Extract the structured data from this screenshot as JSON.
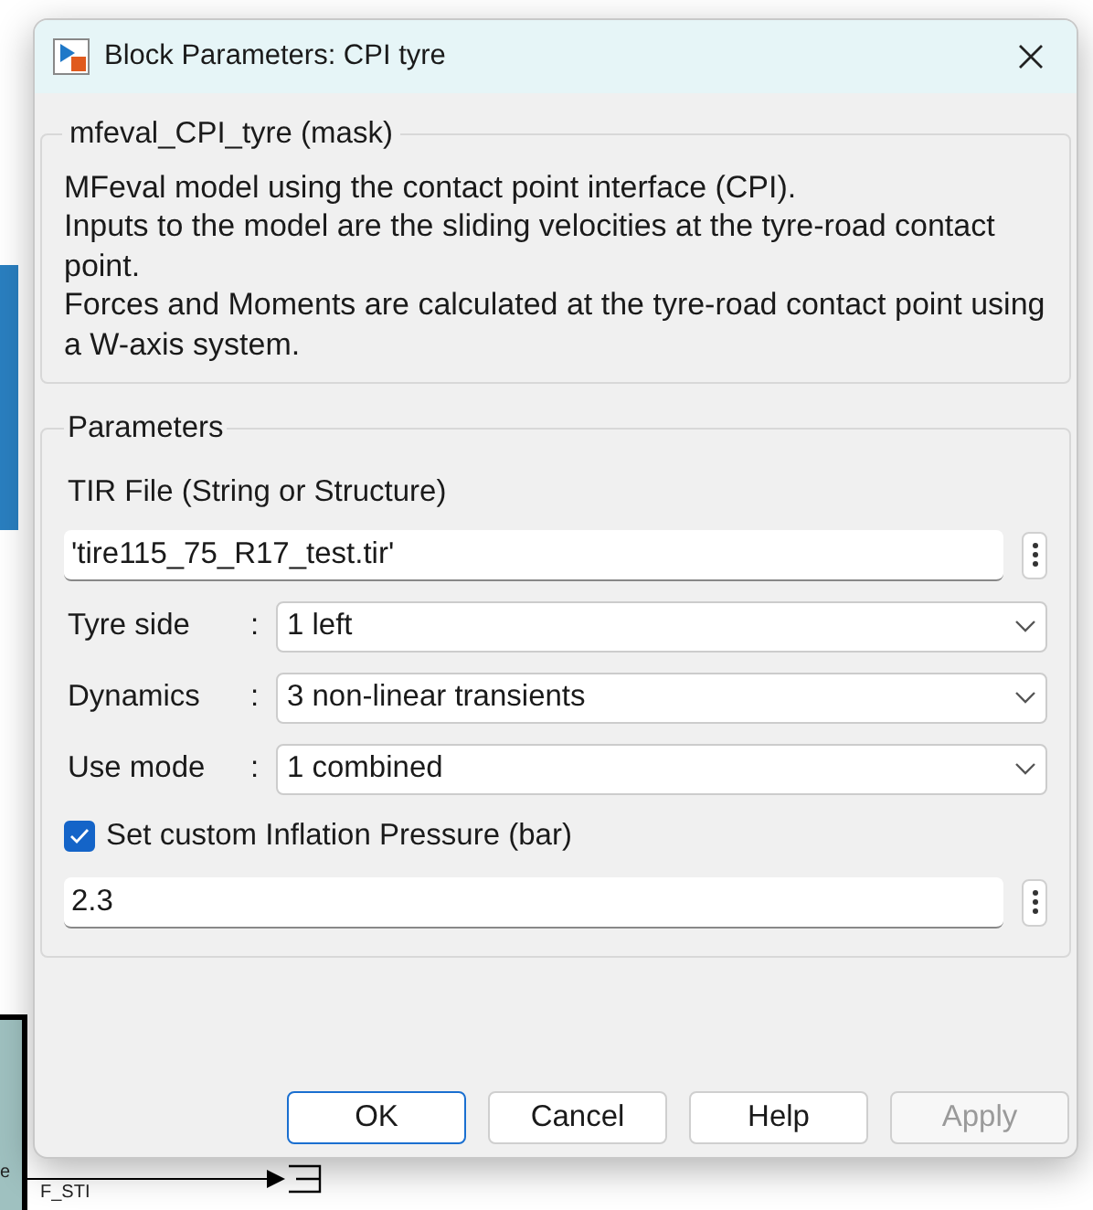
{
  "window": {
    "title": "Block Parameters: CPI tyre"
  },
  "description_group": {
    "title": "mfeval_CPI_tyre (mask)",
    "paragraphs": [
      "MFeval model using the contact point interface (CPI).",
      "Inputs to the model are the sliding velocities at the tyre-road contact point.",
      "Forces and Moments are calculated at the tyre-road contact point using a W-axis system."
    ]
  },
  "parameters": {
    "title": "Parameters",
    "tir_file": {
      "label": "TIR File (String or Structure)",
      "value": "'tire115_75_R17_test.tir'"
    },
    "dropdowns": [
      {
        "label": "Tyre side",
        "separator": ":",
        "value": "1 left"
      },
      {
        "label": "Dynamics",
        "separator": ":",
        "value": "3 non-linear transients"
      },
      {
        "label": "Use mode",
        "separator": ":",
        "value": "1 combined"
      }
    ],
    "pressure": {
      "label": "Set custom Inflation Pressure (bar)",
      "checked": true,
      "value": "2.3"
    }
  },
  "buttons": [
    {
      "label": "OK",
      "kind": "default",
      "disabled": false
    },
    {
      "label": "Cancel",
      "kind": "normal",
      "disabled": false
    },
    {
      "label": "Help",
      "kind": "normal",
      "disabled": false
    },
    {
      "label": "Apply",
      "kind": "normal",
      "disabled": true
    }
  ],
  "background_labels": [
    "e",
    "F_STI"
  ]
}
